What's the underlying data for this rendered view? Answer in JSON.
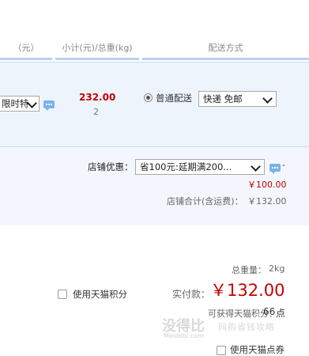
{
  "header": {
    "col_price": "（元）",
    "col_subtotal": "小计(元)/总重(kg)",
    "col_shipping": "配送方式"
  },
  "item": {
    "option_value": "限时特",
    "subtotal": "232.00",
    "weight": "2",
    "shipping_radio_label": "普通配送",
    "shipping_method": "快递 免邮"
  },
  "shop": {
    "discount_label": "店铺优惠：",
    "discount_value": "省100元:延期满200...",
    "discount_dash": "-",
    "discount_amount": "￥100.00",
    "shop_total_label": "店铺合计(含运费)：",
    "shop_total_value": "￥132.00"
  },
  "order": {
    "total_weight_label": "总重量：",
    "total_weight_value": "2kg",
    "use_points_label": "使用天猫积分",
    "paid_label": "实付款：",
    "paid_value": "￥132.00",
    "points_earn_label": "可获得天猫积分：",
    "points_earn_value": "66",
    "points_unit": "点",
    "use_coupon_label": "使用天猫点券"
  },
  "watermark": {
    "text": "没得比",
    "sub": "Meidebi.com",
    "slogan": "网购省钱攻略"
  },
  "colors": {
    "accent_red": "#c40000",
    "header_line": "#b9d0ef",
    "row_bg": "#eef4fc"
  }
}
